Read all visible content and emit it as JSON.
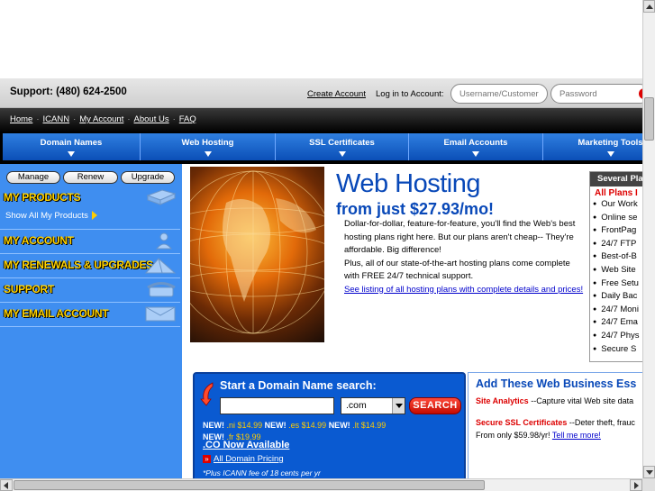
{
  "header": {
    "support": "Support: (480) 624-2500",
    "create_account": "Create Account",
    "login_label": "Log in to Account:",
    "username_placeholder": "Username/Customer #",
    "password_placeholder": "Password"
  },
  "links": [
    "Home",
    "ICANN",
    "My Account",
    "About Us",
    "FAQ"
  ],
  "nav_tabs": [
    "Domain Names",
    "Web Hosting",
    "SSL Certificates",
    "Email Accounts",
    "Marketing Tools"
  ],
  "sidebar": {
    "buttons": [
      "Manage",
      "Renew",
      "Upgrade"
    ],
    "sections": [
      "MY PRODUCTS",
      "MY ACCOUNT",
      "MY RENEWALS & UPGRADES",
      "SUPPORT",
      "MY EMAIL ACCOUNT"
    ],
    "show_all": "Show All My Products"
  },
  "hero": {
    "title": "Web Hosting",
    "price": "from just $27.93/mo!",
    "para1": "Dollar-for-dollar, feature-for-feature, you'll find the Web's best hosting plans right here. But our plans aren't cheap-- They're affordable. Big difference!",
    "para2": "Plus, all of our state-of-the-art hosting plans come complete with FREE 24/7 technical support.",
    "link": "See listing of all hosting plans with complete details and prices!"
  },
  "plans": {
    "header": "Several Pla",
    "sub": "All Plans I",
    "items": [
      "Our Work",
      "Online se",
      "FrontPag",
      "24/7 FTP",
      "Best-of-B",
      "Web Site",
      "Free Setu",
      "Daily Bac",
      "24/7 Moni",
      "24/7 Ema",
      "24/7 Phys",
      "Secure S"
    ]
  },
  "domain_search": {
    "title": "Start a Domain Name search:",
    "tld": ".com",
    "button": "SEARCH",
    "promo1": [
      {
        "label": "NEW!",
        "tld": ".ni",
        "price": "$14.99"
      },
      {
        "label": "NEW!",
        "tld": ".es",
        "price": "$14.99"
      },
      {
        "label": "NEW!",
        "tld": ".lt",
        "price": "$14.99"
      }
    ],
    "promo2": {
      "label": "NEW!",
      "tld": ".fr",
      "price": "$19.99"
    },
    "co": ".CO Now Available",
    "pricing": "All Domain Pricing",
    "icann": "*Plus ICANN fee of 18 cents per yr"
  },
  "business": {
    "title": "Add These Web Business Ess",
    "analytics_label": "Site Analytics",
    "analytics_text": " --Capture vital Web site data",
    "ssl_label": "Secure SSL Certificates",
    "ssl_text": " --Deter theft, frauc",
    "ssl_price": "From only $59.98/yr! ",
    "ssl_link": "Tell me more!"
  },
  "colors": {
    "brand_blue": "#0848b8",
    "sidebar_blue": "#3f8ef0",
    "section_yellow": "#ffd200",
    "accent_red": "#d00"
  }
}
